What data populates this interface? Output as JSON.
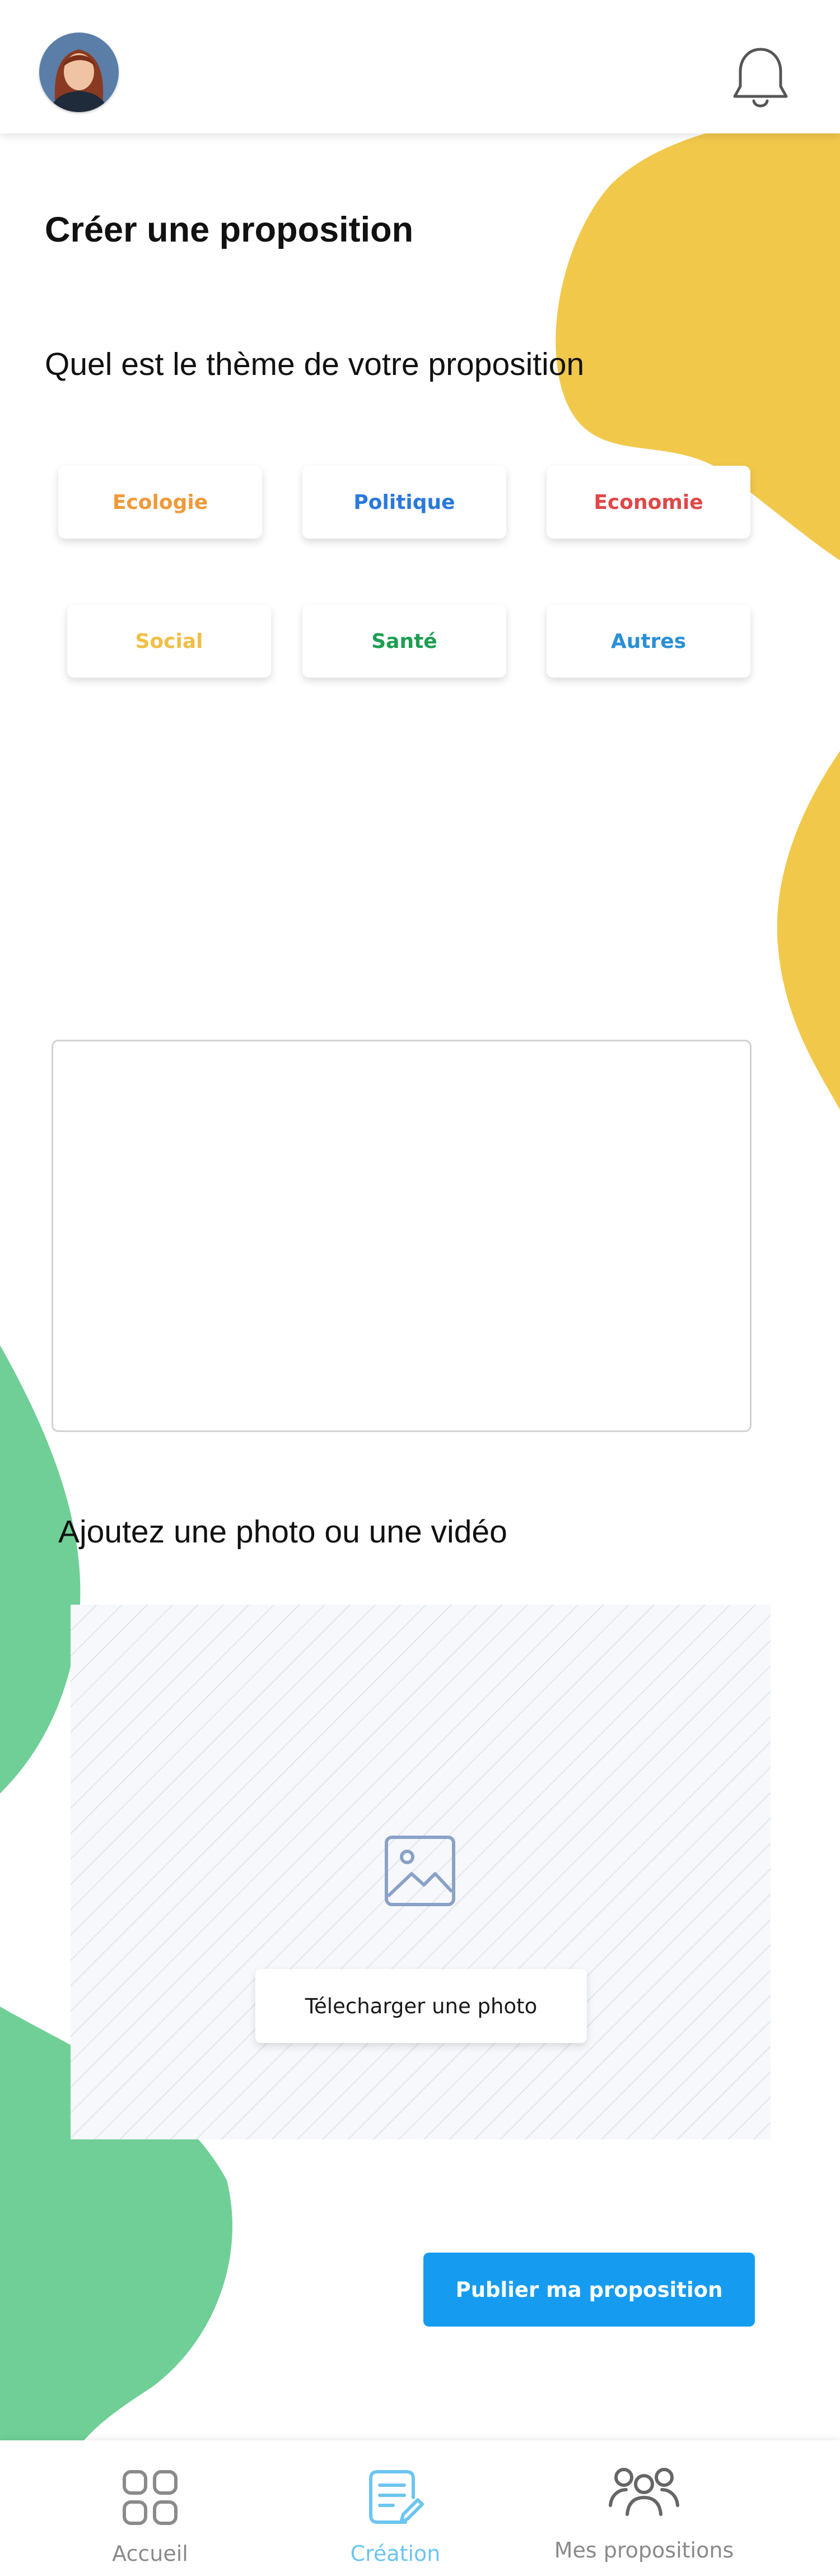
{
  "page": {
    "title": "Créer une proposition",
    "theme_question": "Quel est le thème de votre proposition",
    "photo_label": "Ajoutez une photo ou une vidéo"
  },
  "header": {
    "avatar_icon": "user-avatar-photo",
    "bell_icon": "bell-icon"
  },
  "themes": [
    {
      "label": "Ecologie",
      "color": "#ef9a3a"
    },
    {
      "label": "Politique",
      "color": "#2a78db"
    },
    {
      "label": "Economie",
      "color": "#e04848"
    },
    {
      "label": "Social",
      "color": "#f0bf45"
    },
    {
      "label": "Santé",
      "color": "#1e9e52"
    },
    {
      "label": "Autres",
      "color": "#2a8fd6"
    }
  ],
  "description": {
    "value": ""
  },
  "upload": {
    "icon": "image-icon",
    "button_label": "Télecharger une photo"
  },
  "publish": {
    "label": "Publier ma proposition",
    "color": "#159cf0"
  },
  "nav": [
    {
      "label": "Accueil",
      "icon": "grid-icon",
      "active": false
    },
    {
      "label": "Création",
      "icon": "document-edit-icon",
      "active": true
    },
    {
      "label": "Mes propositions",
      "icon": "group-icon",
      "active": false
    }
  ],
  "colors": {
    "accent_yellow": "#f2c84b",
    "accent_green": "#70cf96",
    "active_nav": "#6cc5f0",
    "inactive_nav": "#8a8a8a"
  }
}
